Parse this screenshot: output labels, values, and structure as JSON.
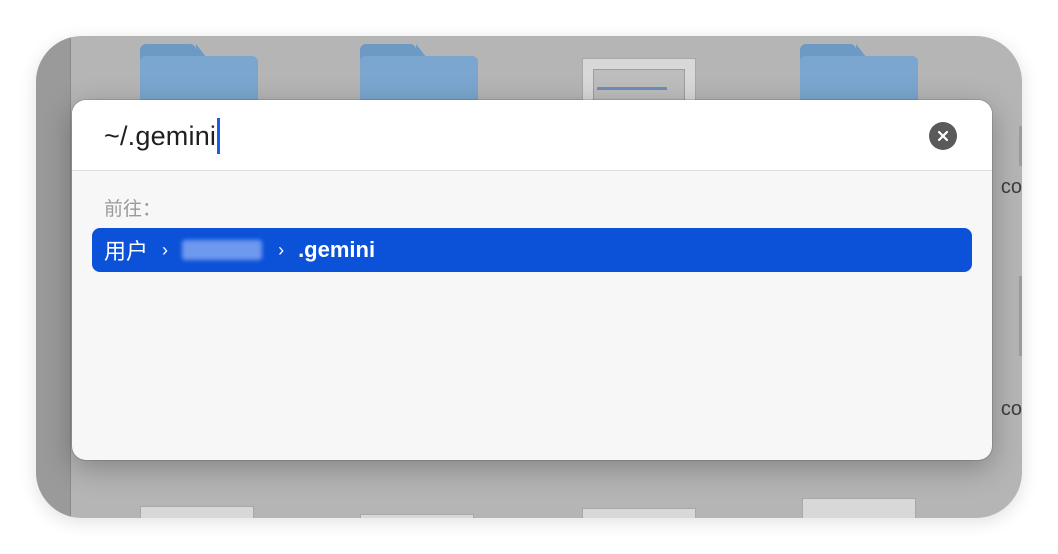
{
  "goto_dialog": {
    "path_input_value": ".gemini",
    "path_prefix": "~/",
    "section_label": "前往：",
    "suggestion": {
      "crumbs": [
        "用户",
        "username",
        ".gemini"
      ],
      "blurred_index": 1
    },
    "clear_button_label": "Clear"
  },
  "background": {
    "side_text_1": "co",
    "side_text_2": "co"
  },
  "colors": {
    "selection_accent": "#0b52d8",
    "caret": "#1a5bf0"
  },
  "icons": {
    "clear": "x-circle-icon",
    "chevron": "chevron-right-icon",
    "folder": "folder-icon"
  }
}
